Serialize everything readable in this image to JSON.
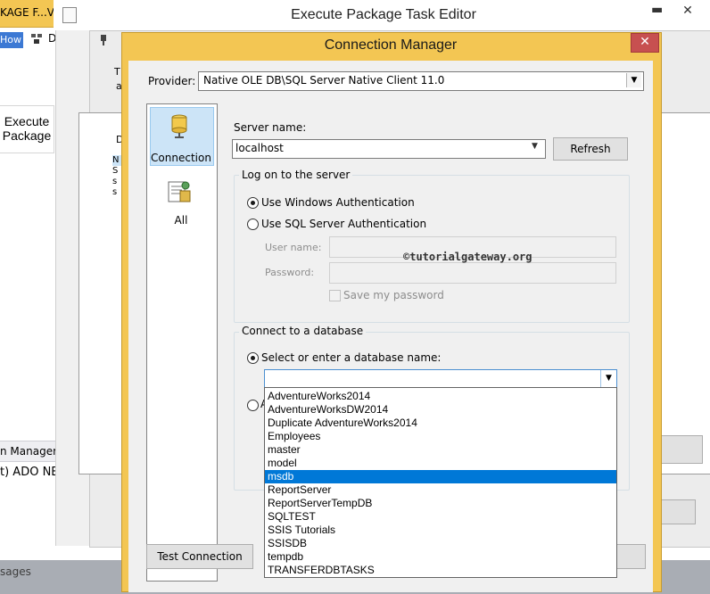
{
  "background": {
    "tab_label": "KAGE F...VE",
    "toolbar_label": "How",
    "toolbar_d": "D",
    "execute_package_line1": "Execute",
    "execute_package_line2": "Package",
    "connection_managers_tab": "n Managers",
    "ado_item": "t) ADO NE",
    "status_text": "sages"
  },
  "task_editor": {
    "title": "Execute Package Task Editor",
    "min_glyph": "▬",
    "close_glyph": "✕",
    "label_t": "T",
    "label_a": "a",
    "label_d": "D",
    "list_items": [
      "N",
      "S",
      "s",
      "s"
    ]
  },
  "connection_manager": {
    "title": "Connection Manager",
    "close_glyph": "✕",
    "provider_label": "Provider:",
    "provider_value": "Native OLE DB\\SQL Server Native Client 11.0",
    "nav": {
      "connection_label": "Connection",
      "all_label": "All"
    },
    "server_name_label": "Server name:",
    "server_name_value": "localhost",
    "refresh_label": "Refresh",
    "logon_group_title": "Log on to the server",
    "use_windows_auth": "Use Windows Authentication",
    "use_sql_auth": "Use SQL Server Authentication",
    "user_name_label": "User name:",
    "password_label": "Password:",
    "save_password_label": "Save my password",
    "watermark": "©tutorialgateway.org",
    "connect_db_group_title": "Connect to a database",
    "select_db_label": "Select or enter a database name:",
    "attach_label": "A",
    "database_options": [
      "AdventureWorks2014",
      "AdventureWorksDW2014",
      "Duplicate AdventureWorks2014",
      "Employees",
      "master",
      "model",
      "msdb",
      "ReportServer",
      "ReportServerTempDB",
      "SQLTEST",
      "SSIS Tutorials",
      "SSISDB",
      "tempdb",
      "TRANSFERDBTASKS"
    ],
    "selected_database": "msdb",
    "test_connection_label": "Test Connection"
  },
  "colors": {
    "dialog_border": "#f3c653",
    "selection": "#0078d7",
    "close_button": "#c75050"
  }
}
